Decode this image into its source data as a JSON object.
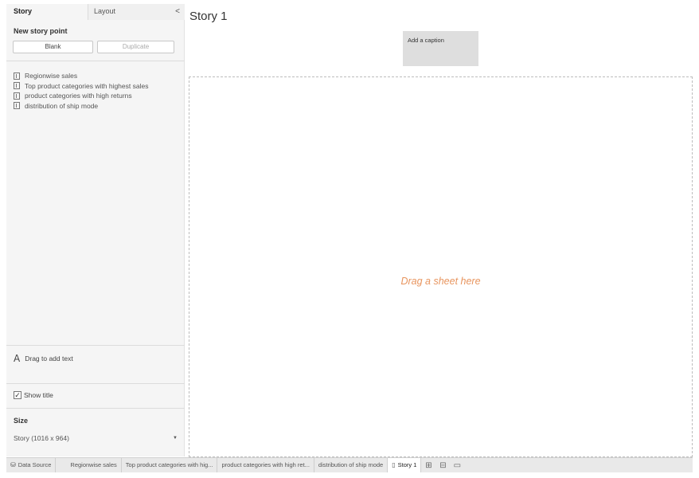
{
  "panel": {
    "tabs": {
      "story": "Story",
      "layout": "Layout",
      "collapse_glyph": "<"
    },
    "new_story_point": {
      "title": "New story point",
      "blank_label": "Blank",
      "duplicate_label": "Duplicate"
    },
    "sheets": [
      {
        "label": "Regionwise sales"
      },
      {
        "label": "Top product categories with highest sales"
      },
      {
        "label": "product categories with high returns"
      },
      {
        "label": "distribution of ship mode"
      }
    ],
    "drag_text": {
      "glyph": "A",
      "label": "Drag to add text"
    },
    "show_title": {
      "label": "Show title",
      "checked": true,
      "check_glyph": "✓"
    },
    "size": {
      "title": "Size",
      "selected": "Story (1016 x 964)",
      "arrow": "▼"
    }
  },
  "main": {
    "story_title": "Story 1",
    "caption_placeholder": "Add a caption",
    "drop_hint": "Drag a sheet here",
    "drop_hint_color": "#e8955f"
  },
  "bottom_tabs": {
    "data_source": {
      "glyph": "⛁",
      "label": "Data Source"
    },
    "sheets": [
      {
        "label": "Regionwise sales"
      },
      {
        "label": "Top product categories with hig..."
      },
      {
        "label": "product categories with high ret..."
      },
      {
        "label": "distribution of ship mode"
      }
    ],
    "story": {
      "glyph": "▯",
      "label": "Story 1"
    },
    "new_icons": [
      {
        "name": "new-worksheet-icon",
        "glyph": "⊞"
      },
      {
        "name": "new-dashboard-icon",
        "glyph": "⊟"
      },
      {
        "name": "new-story-icon",
        "glyph": "▭"
      }
    ]
  }
}
